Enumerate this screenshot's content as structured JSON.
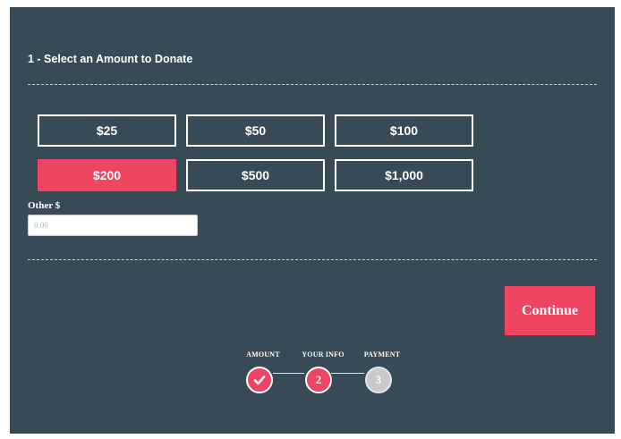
{
  "form": {
    "step_title": "1 - Select an Amount to Donate",
    "amounts": [
      {
        "label": "$25",
        "selected": false
      },
      {
        "label": "$50",
        "selected": false
      },
      {
        "label": "$100",
        "selected": false
      },
      {
        "label": "$200",
        "selected": true
      },
      {
        "label": "$500",
        "selected": false
      },
      {
        "label": "$1,000",
        "selected": false
      }
    ],
    "other_label": "Other $",
    "other_placeholder": "0.00",
    "other_value": "",
    "continue_label": "Continue"
  },
  "stepper": {
    "steps": [
      {
        "label": "AMOUNT",
        "marker": "",
        "state": "done",
        "icon": "checkmark-icon"
      },
      {
        "label": "YOUR INFO",
        "marker": "2",
        "state": "active"
      },
      {
        "label": "PAYMENT",
        "marker": "3",
        "state": "pending"
      }
    ]
  },
  "colors": {
    "background": "#374a56",
    "accent": "#ee4562",
    "pending_step": "#c9c9c9"
  }
}
